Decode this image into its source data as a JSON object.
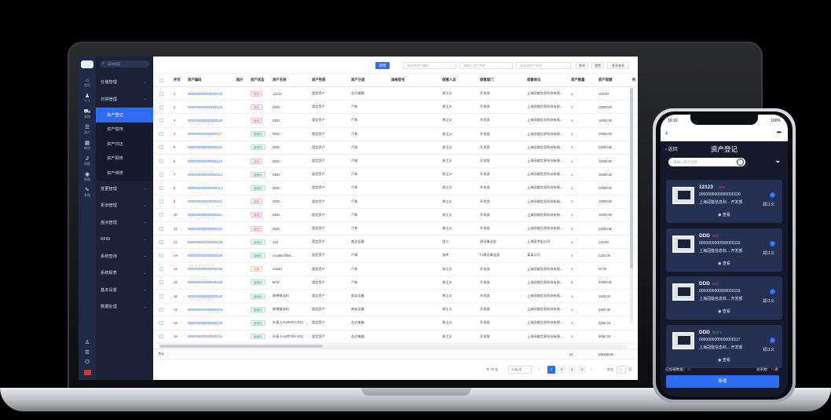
{
  "app": {
    "search_placeholder": "菜单搜索"
  },
  "rail": [
    {
      "icon": "home-icon",
      "glyph": "⌂",
      "label": "首页"
    },
    {
      "icon": "person-icon",
      "glyph": "♟",
      "label": "个人"
    },
    {
      "icon": "cart-icon",
      "glyph": "⛟",
      "label": "采购"
    },
    {
      "icon": "database-icon",
      "glyph": "☰",
      "label": "资产"
    },
    {
      "icon": "grid-icon",
      "glyph": "▦",
      "label": "耗材"
    },
    {
      "icon": "link-icon",
      "glyph": "∂",
      "label": "流程"
    },
    {
      "icon": "location-icon",
      "glyph": "◉",
      "label": "地图"
    },
    {
      "icon": "wrench-icon",
      "glyph": "✎",
      "label": "系统"
    }
  ],
  "menu": {
    "groups_top": [
      "仓储管理",
      "日常管理"
    ],
    "subs": [
      "资产登记",
      "资产借用",
      "资产归还",
      "资产报修",
      "资产维修"
    ],
    "groups_bottom": [
      "变更管理",
      "折旧管理",
      "盘点管理",
      "RFID",
      "系统查询",
      "系统报表",
      "基本设置",
      "数据处理"
    ]
  },
  "toolbar": {
    "add_label": "新增",
    "filter1_placeholder": "请查询资产编码",
    "filter2_placeholder": "请输入资产名称",
    "filter3_placeholder": "请选择资产状态",
    "query_label": "查询",
    "reset_label": "重置",
    "more_label": "更多查询"
  },
  "table": {
    "headers": [
      "序号",
      "资产编码",
      "照片",
      "资产状态",
      "资产名称",
      "资产性质",
      "资产分类",
      "规格型号",
      "保管人员",
      "保管部门",
      "保管单位",
      "资产数量",
      "资产金额",
      "所"
    ],
    "rows": [
      [
        "1",
        "0000000000000000120",
        "",
        "待分",
        "12123",
        "固定资产",
        "台式电脑",
        "",
        "郑江义",
        "开发部",
        "上海冠能信息科技有限...",
        "1",
        "123.00"
      ],
      [
        "2",
        "0000000000000000119",
        "",
        "待分",
        "DDD",
        "固定资产",
        "汽车",
        "",
        "郑江义",
        "开发部",
        "上海冠能信息科技有限...",
        "1",
        "10000.00"
      ],
      [
        "3",
        "0000000000000000118",
        "",
        "待分",
        "DDD",
        "固定资产",
        "汽车",
        "",
        "郑江义",
        "开发部",
        "上海冠能信息科技有限...",
        "1",
        "10000.00"
      ],
      [
        "4",
        "0000000000000000117",
        "",
        "使用中",
        "DDD",
        "固定资产",
        "汽车",
        "",
        "郑江义",
        "开发部",
        "上海冠能信息科技有限...",
        "1",
        "10000.00"
      ],
      [
        "5",
        "0000000000000000116",
        "",
        "使用中",
        "DDD",
        "固定资产",
        "汽车",
        "",
        "郑江义",
        "开发部",
        "上海冠能信息科技有限...",
        "1",
        "10000.00"
      ],
      [
        "6",
        "0000000000000000115",
        "",
        "待分",
        "DDD",
        "固定资产",
        "汽车",
        "",
        "郑江义",
        "开发部",
        "上海冠能信息科技有限...",
        "1",
        "10000.00"
      ],
      [
        "7",
        "0000000000000000114",
        "",
        "使用中",
        "DDD",
        "固定资产",
        "汽车",
        "",
        "郑江义",
        "开发部",
        "上海冠能信息科技有限...",
        "1",
        "10000.00"
      ],
      [
        "8",
        "0000000000000000113",
        "",
        "使用中",
        "DDD",
        "固定资产",
        "汽车",
        "",
        "郑江义",
        "开发部",
        "上海冠能信息科技有限...",
        "1",
        "10000.00"
      ],
      [
        "9",
        "0000000000000000112",
        "",
        "待分",
        "DDD",
        "固定资产",
        "汽车",
        "",
        "郑江义",
        "开发部",
        "上海冠能信息科技有限...",
        "1",
        "10000.00"
      ],
      [
        "10",
        "0000000000000000111",
        "",
        "待分",
        "DDD",
        "固定资产",
        "汽车",
        "",
        "郑江义",
        "开发部",
        "上海冠能信息科技有限...",
        "1",
        "10000.00"
      ],
      [
        "11",
        "0000000000000000110",
        "",
        "待分",
        "DDD",
        "固定资产",
        "汽车",
        "",
        "郑江义",
        "开发部",
        "上海冠能信息科技有限...",
        "1",
        "10000.00"
      ],
      [
        "12",
        "0000000000000000109",
        "",
        "使用中",
        "123",
        "固定资产",
        "商务设备",
        "",
        "张二",
        "测试事业部",
        "上海某宇出公司",
        "1",
        "123.00"
      ],
      [
        "13",
        "0000000000000000108",
        "",
        "使用中",
        "LocationTest...",
        "固定资产",
        "汽车",
        "",
        "张库",
        "行政办事业部",
        "某某公司",
        "1",
        "1234.00"
      ],
      [
        "14",
        "0000000000000000106",
        "",
        "闲置",
        "ododd",
        "固定资产",
        "汽车",
        "",
        "郑江义",
        "开发部",
        "上海冠能信息科技有限...",
        "1",
        "10.00"
      ],
      [
        "15",
        "0000000000000000105",
        "",
        "使用中",
        "BYD",
        "固定资产",
        "汽车",
        "",
        "郑江义",
        "开发部",
        "上海冠能信息科技有限...",
        "5",
        "40000.00"
      ],
      [
        "16",
        "0000000000000000104",
        "",
        "使用中",
        "联想服务机",
        "固定资产",
        "商务设备",
        "",
        "郑江义",
        "开发部",
        "上海冠能信息科技有限...",
        "1",
        "1500.00"
      ],
      [
        "17",
        "0000000000000000103",
        "",
        "使用中",
        "联想服务机",
        "固定资产",
        "商务设备",
        "",
        "郑江义",
        "开发部",
        "上海冠能信息科技有限...",
        "1",
        "1500.00"
      ],
      [
        "18",
        "0000000000000000102",
        "",
        "使用中",
        "外星人AURORA R12",
        "固定资产",
        "台式电脑",
        "",
        "郑江义",
        "开发部",
        "上海冠能信息科技有限...",
        "1",
        "4666.33"
      ],
      [
        "19",
        "0000000000000000101",
        "",
        "使用中",
        "外星人AURORA R12",
        "固定资产",
        "台式电脑",
        "",
        "郑江义",
        "开发部",
        "上海冠能信息科技有限...",
        "1",
        "4666.33"
      ]
    ],
    "total_label": "合计",
    "total_qty": "24",
    "total_amount": "158488.99"
  },
  "pager": {
    "total_text": "共 76 条",
    "page_size": "20条/页",
    "pages": [
      "1",
      "2",
      "3",
      "4"
    ],
    "current": "1",
    "goto_label": "前往",
    "goto_value": "1",
    "goto_suffix": "页"
  },
  "phone": {
    "time": "16:16",
    "battery": "100%",
    "back_label": "‹ 返回",
    "title": "资产登记",
    "search_placeholder": "请输入资产名称",
    "cards": [
      {
        "name": "12123",
        "status": "待分",
        "code": "0000000000000000120",
        "org": "上海冠能信息科... 开发部",
        "user": "郑江义",
        "view": "查看"
      },
      {
        "name": "DDD",
        "status": "待分",
        "code": "0000000000000000119",
        "org": "上海冠能信息科... 开发部",
        "user": "郑江义",
        "view": "查看"
      },
      {
        "name": "DDD",
        "status": "待分",
        "code": "0000000000000000118",
        "org": "上海冠能信息科... 开发部",
        "user": "郑江义",
        "view": "查看"
      },
      {
        "name": "DDD",
        "status": "使用中",
        "code": "0000000000000000117",
        "org": "上海冠能信息科... 开发部",
        "user": "郑江义",
        "view": "查看"
      }
    ],
    "loaded_label": "已加载数据：",
    "loaded_value": "20",
    "total_label": "总条数：",
    "total_value": "76",
    "total_suffix": "条",
    "add_label": "新增"
  },
  "colors": {
    "primary": "#2d6cf6",
    "sidebar": "#1b2236",
    "pending": "#e3358a",
    "inuse": "#1aa06d",
    "idle": "#e39a12"
  }
}
